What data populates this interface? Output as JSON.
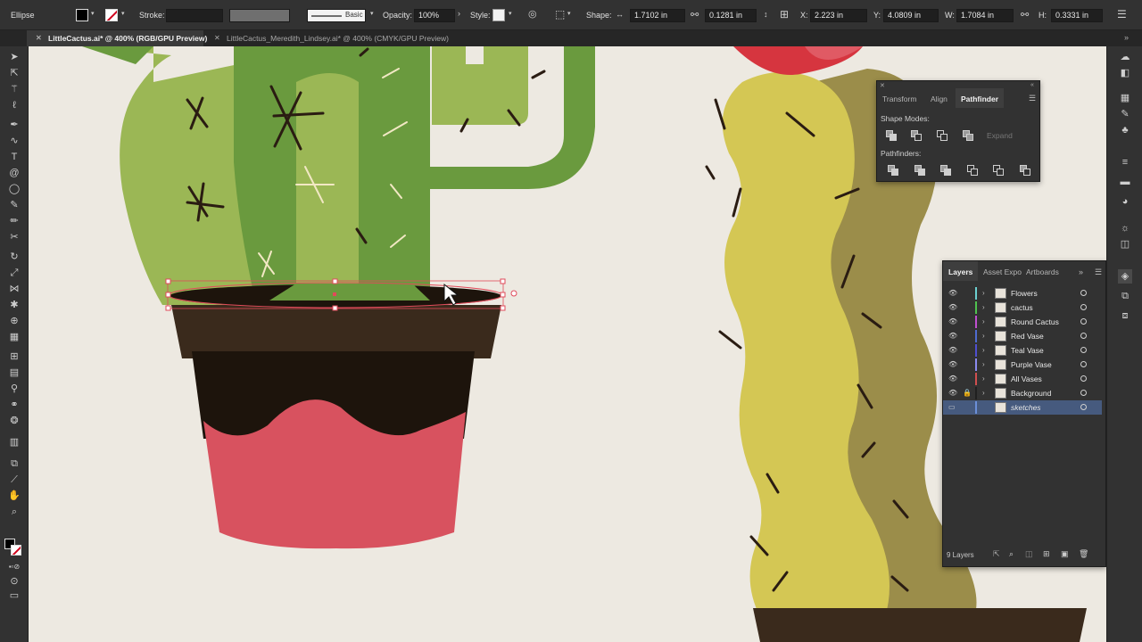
{
  "control_bar": {
    "selection_label": "Ellipse",
    "stroke_label": "Stroke:",
    "brush_label": "Basic",
    "opacity_label": "Opacity:",
    "opacity_value": "100%",
    "style_label": "Style:",
    "shape_label": "Shape:",
    "shape_width": "1.7102 in",
    "shape_height": "0.1281 in",
    "x_label": "X:",
    "x_value": "2.223 in",
    "y_label": "Y:",
    "y_value": "4.0809 in",
    "w_label": "W:",
    "w_value": "1.7084 in",
    "h_label": "H:",
    "h_value": "0.3331 in",
    "fill_color": "#000000",
    "stroke_color": "#d0021b"
  },
  "tabs": [
    {
      "label": "LittleCactus.ai* @ 400% (RGB/GPU Preview)",
      "active": true
    },
    {
      "label": "LittleCactus_Meredith_Lindsey.ai* @ 400% (CMYK/GPU Preview)",
      "active": false
    }
  ],
  "pathfinder_panel": {
    "tabs": [
      "Transform",
      "Align",
      "Pathfinder"
    ],
    "active_tab": "Pathfinder",
    "shape_modes_label": "Shape Modes:",
    "expand_label": "Expand",
    "pathfinders_label": "Pathfinders:"
  },
  "layers_panel": {
    "tabs": [
      "Layers",
      "Asset Expo",
      "Artboards"
    ],
    "active_tab": "Layers",
    "layers": [
      {
        "name": "Flowers",
        "color": "#6bd0d0",
        "locked": false,
        "selected": false
      },
      {
        "name": "cactus",
        "color": "#4fc24f",
        "locked": false,
        "selected": false
      },
      {
        "name": "Round Cactus",
        "color": "#c04fd0",
        "locked": false,
        "selected": false
      },
      {
        "name": "Red Vase",
        "color": "#4f6bd0",
        "locked": false,
        "selected": false
      },
      {
        "name": "Teal Vase",
        "color": "#4f4fd0",
        "locked": false,
        "selected": false
      },
      {
        "name": "Purple Vase",
        "color": "#8a8af0",
        "locked": false,
        "selected": false
      },
      {
        "name": "All Vases",
        "color": "#d04f4f",
        "locked": false,
        "selected": false
      },
      {
        "name": "Background",
        "color": "#202020",
        "locked": true,
        "selected": false
      },
      {
        "name": "sketches",
        "color": "#6b8fd8",
        "locked": false,
        "selected": true
      }
    ],
    "footer_count": "9 Layers"
  },
  "colors": {
    "canvas": "#ede9e1",
    "cactus_light": "#9bb755",
    "cactus_dark": "#6a9a3e",
    "pot_rim": "#3a2a1c",
    "pot_band": "#1d140c",
    "pot_pink": "#d8525f",
    "round_cactus": "#d4c754",
    "round_cactus_shadow": "#9b8d4a",
    "flower_red": "#d6353f",
    "selection": "#e04a5a"
  },
  "icons": {
    "tools": [
      "selection-icon",
      "direct-selection-icon",
      "magic-wand-icon",
      "lasso-icon",
      "pen-icon",
      "curvature-icon",
      "type-icon",
      "spiral-icon",
      "ellipse-icon",
      "paintbrush-icon",
      "pencil-icon",
      "scissors-icon",
      "rotate-icon",
      "scale-icon",
      "width-icon",
      "puppet-warp-icon",
      "shape-builder-icon",
      "perspective-icon",
      "mesh-icon",
      "gradient-icon",
      "eyedropper-icon",
      "blend-icon",
      "symbol-sprayer-icon",
      "graph-icon",
      "artboard-icon",
      "slice-icon",
      "hand-icon",
      "zoom-icon"
    ],
    "dock": [
      "cc-libraries-icon",
      "properties-icon",
      "swatches-icon",
      "brushes-icon",
      "symbols-icon",
      "stroke-icon",
      "gradient-panel-icon",
      "transparency-icon",
      "appearance-icon",
      "graphic-styles-icon",
      "layers-icon",
      "artboards-icon",
      "links-icon"
    ]
  }
}
